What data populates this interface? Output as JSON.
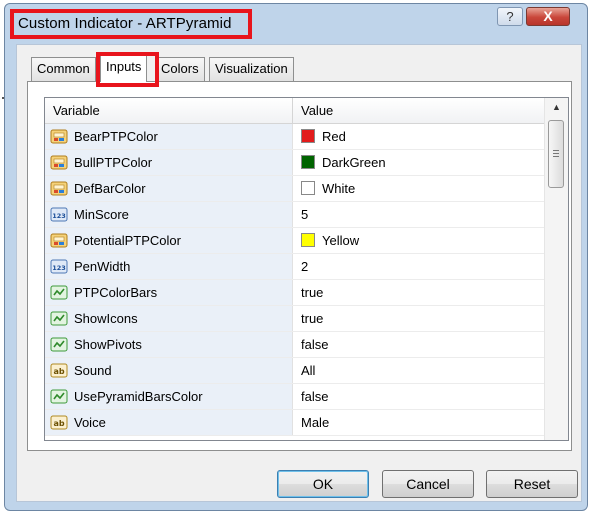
{
  "window": {
    "title": "Custom Indicator - ARTPyramid",
    "help_label": "?",
    "close_label": "X"
  },
  "tabs": [
    {
      "label": "Common",
      "active": false
    },
    {
      "label": "Inputs",
      "active": true
    },
    {
      "label": "Colors",
      "active": false
    },
    {
      "label": "Visualization",
      "active": false
    }
  ],
  "grid": {
    "header": {
      "variable": "Variable",
      "value": "Value"
    },
    "rows": [
      {
        "name": "BearPTPColor",
        "icon": "color-icon",
        "value": "Red",
        "swatch": "#e21b1b"
      },
      {
        "name": "BullPTPColor",
        "icon": "color-icon",
        "value": "DarkGreen",
        "swatch": "#006400"
      },
      {
        "name": "DefBarColor",
        "icon": "color-icon",
        "value": "White",
        "swatch": "#ffffff"
      },
      {
        "name": "MinScore",
        "icon": "integer-icon",
        "value": "5",
        "swatch": null
      },
      {
        "name": "PotentialPTPColor",
        "icon": "color-icon",
        "value": "Yellow",
        "swatch": "#ffff00"
      },
      {
        "name": "PenWidth",
        "icon": "integer-icon",
        "value": "2",
        "swatch": null
      },
      {
        "name": "PTPColorBars",
        "icon": "boolean-icon",
        "value": "true",
        "swatch": null
      },
      {
        "name": "ShowIcons",
        "icon": "boolean-icon",
        "value": "true",
        "swatch": null
      },
      {
        "name": "ShowPivots",
        "icon": "boolean-icon",
        "value": "false",
        "swatch": null
      },
      {
        "name": "Sound",
        "icon": "string-icon",
        "value": "All",
        "swatch": null
      },
      {
        "name": "UsePyramidBarsColor",
        "icon": "boolean-icon",
        "value": "false",
        "swatch": null
      },
      {
        "name": "Voice",
        "icon": "string-icon",
        "value": "Male",
        "swatch": null
      }
    ]
  },
  "buttons": {
    "ok": "OK",
    "cancel": "Cancel",
    "reset": "Reset"
  },
  "colors": {
    "highlight": "#e8141c",
    "name_cell_bg": "#eaf0f8"
  }
}
